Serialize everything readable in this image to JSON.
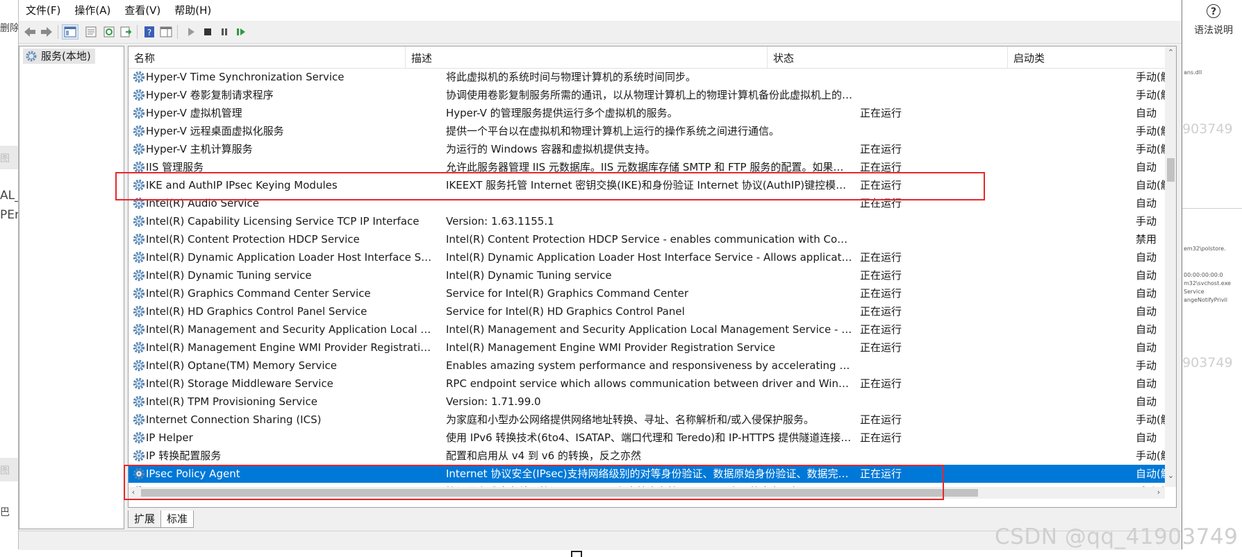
{
  "menu": [
    {
      "label": "文件(F)"
    },
    {
      "label": "操作(A)"
    },
    {
      "label": "查看(V)"
    },
    {
      "label": "帮助(H)"
    }
  ],
  "toolbar_icons": [
    "back-arrow-icon",
    "forward-arrow-icon",
    "show-hide-tree-icon",
    "properties-icon",
    "refresh-icon",
    "export-list-icon",
    "help-icon",
    "show-action-pane-icon",
    "start-service-icon",
    "stop-service-icon",
    "pause-service-icon",
    "resume-service-icon"
  ],
  "tree": {
    "root_label": "服务(本地)"
  },
  "columns": {
    "name": "名称",
    "desc": "描述",
    "status": "状态",
    "startup": "启动类"
  },
  "rows": [
    {
      "name": "Hyper-V Time Synchronization Service",
      "desc": "将此虚拟机的系统时间与物理计算机的系统时间同步。",
      "status": "",
      "startup": "手动(触"
    },
    {
      "name": "Hyper-V 卷影复制请求程序",
      "desc": "协调使用卷影复制服务所需的通讯，以从物理计算机上的物理计算机备份此虚拟机上的应...",
      "status": "",
      "startup": "手动(触"
    },
    {
      "name": "Hyper-V 虚拟机管理",
      "desc": "Hyper-V 的管理服务提供运行多个虚拟机的服务。",
      "status": "正在运行",
      "startup": "自动"
    },
    {
      "name": "Hyper-V 远程桌面虚拟化服务",
      "desc": "提供一个平台以在虚拟机和物理计算机上运行的操作系统之间进行通信。",
      "status": "",
      "startup": "手动(触"
    },
    {
      "name": "Hyper-V 主机计算服务",
      "desc": "为运行的 Windows 容器和虚拟机提供支持。",
      "status": "正在运行",
      "startup": "手动(触"
    },
    {
      "name": "IIS 管理服务",
      "desc": "允许此服务器管理 IIS 元数据库。IIS 元数据库存储 SMTP 和 FTP 服务的配置。如果停...",
      "status": "正在运行",
      "startup": "自动"
    },
    {
      "name": "IKE and AuthIP IPsec Keying Modules",
      "desc": "IKEEXT 服务托管 Internet 密钥交换(IKE)和身份验证 Internet 协议(AuthIP)键控模块。...",
      "status": "正在运行",
      "startup": "自动(触"
    },
    {
      "name": "Intel(R) Audio Service",
      "desc": "",
      "status": "正在运行",
      "startup": "自动"
    },
    {
      "name": "Intel(R) Capability Licensing Service TCP IP Interface",
      "desc": "Version: 1.63.1155.1",
      "status": "",
      "startup": "手动"
    },
    {
      "name": "Intel(R) Content Protection HDCP Service",
      "desc": "Intel(R) Content Protection HDCP Service - enables communication with Content Pr...",
      "status": "",
      "startup": "禁用"
    },
    {
      "name": "Intel(R) Dynamic Application Loader Host Interface Service",
      "desc": "Intel(R) Dynamic Application Loader Host Interface Service - Allows applications to a...",
      "status": "正在运行",
      "startup": "自动"
    },
    {
      "name": "Intel(R) Dynamic Tuning service",
      "desc": "Intel(R) Dynamic Tuning service",
      "status": "正在运行",
      "startup": "自动"
    },
    {
      "name": "Intel(R) Graphics Command Center Service",
      "desc": "Service for Intel(R) Graphics Command Center",
      "status": "正在运行",
      "startup": "自动"
    },
    {
      "name": "Intel(R) HD Graphics Control Panel Service",
      "desc": "Service for Intel(R) HD Graphics Control Panel",
      "status": "正在运行",
      "startup": "自动"
    },
    {
      "name": "Intel(R) Management and Security Application Local Manag...",
      "desc": "Intel(R) Management and Security Application Local Management Service - Provide...",
      "status": "正在运行",
      "startup": "自动"
    },
    {
      "name": "Intel(R) Management Engine WMI Provider Registration",
      "desc": "Intel(R) Management Engine WMI Provider Registration Service",
      "status": "正在运行",
      "startup": "自动"
    },
    {
      "name": "Intel(R) Optane(TM) Memory Service",
      "desc": "Enables amazing system performance and responsiveness by accelerating frequently...",
      "status": "",
      "startup": "手动"
    },
    {
      "name": "Intel(R) Storage Middleware Service",
      "desc": "RPC endpoint service which allows communication between driver and Windows St...",
      "status": "正在运行",
      "startup": "自动"
    },
    {
      "name": "Intel(R) TPM Provisioning Service",
      "desc": "Version: 1.71.99.0",
      "status": "",
      "startup": "自动"
    },
    {
      "name": "Internet Connection Sharing (ICS)",
      "desc": "为家庭和小型办公网络提供网络地址转换、寻址、名称解析和/或入侵保护服务。",
      "status": "正在运行",
      "startup": "手动(触"
    },
    {
      "name": "IP Helper",
      "desc": "使用 IPv6 转换技术(6to4、ISATAP、端口代理和 Teredo)和 IP-HTTPS 提供隧道连接。...",
      "status": "正在运行",
      "startup": "自动"
    },
    {
      "name": "IP 转换配置服务",
      "desc": "配置和启用从 v4 到 v6 的转换，反之亦然",
      "status": "",
      "startup": "手动(触"
    },
    {
      "name": "IPsec Policy Agent",
      "desc": "Internet 协议安全(IPsec)支持网络级别的对等身份验证、数据原始身份验证、数据完整...",
      "status": "正在运行",
      "startup": "自动(触",
      "selected": true
    },
    {
      "name": "KtmRm for Distributed Transaction Coordinator",
      "desc": "协调分布式事务处理协调器(MSDTC)和内核事务管理器(KTM)之间的事务。如果不需要...",
      "status": "",
      "startup": "手动(触"
    }
  ],
  "tabs": [
    {
      "label": "扩展"
    },
    {
      "label": "标准"
    }
  ],
  "background": {
    "left_fragments": [
      "删除",
      "图",
      "AL_",
      "PEr",
      "图",
      "巴"
    ],
    "right_fragments": [
      "ans.dll",
      "em32\\polstore.",
      "00:00:00:00:0",
      "m32\\svchost.exe",
      "Service",
      "angeNotifyPrivil"
    ],
    "ghost_digits": "903749",
    "help_label": "语法说明",
    "help_glyph": "?"
  },
  "watermark": "CSDN @qq_41903749",
  "colors": {
    "selection": "#0078d7",
    "annotation": "#e8262b",
    "gear": "#5a87b4"
  }
}
